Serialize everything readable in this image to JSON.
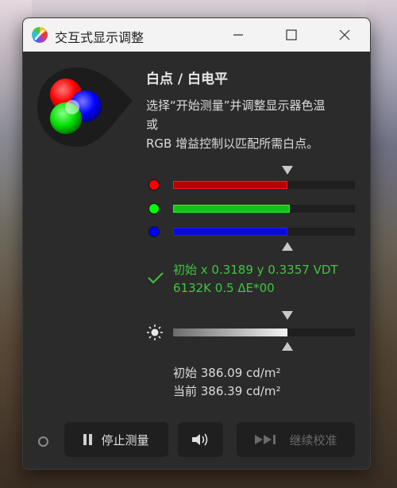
{
  "window": {
    "title": "交互式显示调整"
  },
  "main": {
    "heading": "白点 / 白电平",
    "description_lines": [
      "选择“开始测量”并调整显示器色温",
      "或",
      "RGB 增益控制以匹配所需白点。"
    ]
  },
  "sliders": {
    "red_fill": 0.63,
    "green_fill": 0.64,
    "blue_fill": 0.63,
    "white_fill": 0.63,
    "colors": {
      "red": "#ff0000",
      "green": "#00ff00",
      "blue": "#0000ff"
    }
  },
  "status": {
    "line1": "初始 x 0.3189 y 0.3357 VDT",
    "line2": "6132K 0.5 ΔE*00",
    "color": "#3fc63f"
  },
  "luminance": {
    "initial": "初始 386.09 cd/m²",
    "current": "当前 386.39 cd/m²"
  },
  "footer": {
    "stop_button_label": "停止测量",
    "continue_button_label": "继续校准"
  },
  "icons": {
    "app": "color-wheel-icon",
    "minimize": "minimize-icon",
    "maximize": "maximize-icon",
    "close": "close-icon",
    "check": "check-icon",
    "brightness": "sun-icon",
    "pause": "pause-icon",
    "speaker": "speaker-icon",
    "skip": "skip-forward-icon"
  }
}
